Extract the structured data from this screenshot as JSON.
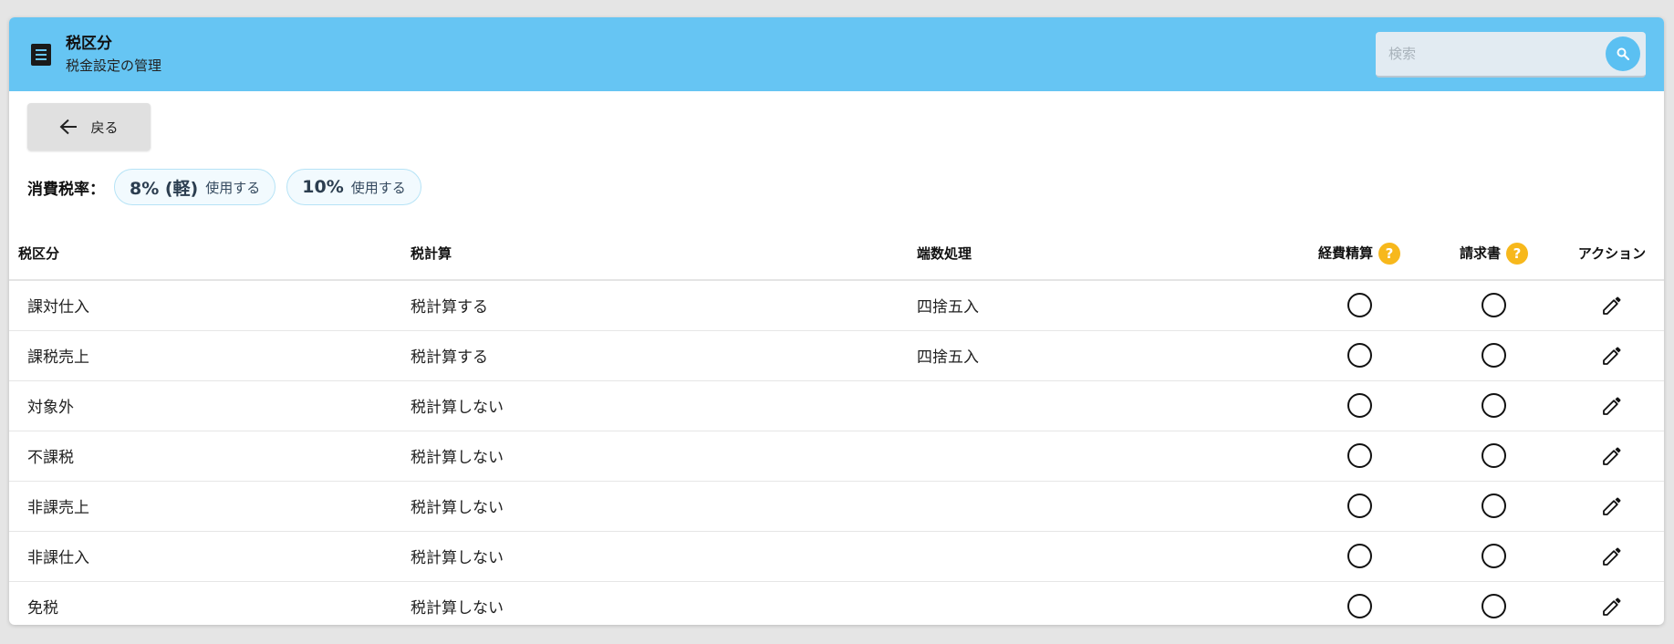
{
  "header": {
    "title": "税区分",
    "subtitle": "税金設定の管理",
    "search_placeholder": "検索"
  },
  "back_label": "戻る",
  "rates": {
    "label": "消費税率：",
    "items": [
      {
        "rate": "8% (軽)",
        "status": "使用する"
      },
      {
        "rate": "10%",
        "status": "使用する"
      }
    ]
  },
  "table": {
    "columns": [
      "税区分",
      "税計算",
      "端数処理",
      "経費精算",
      "請求書",
      "アクション"
    ],
    "help_glyph": "?",
    "rows": [
      {
        "category": "課対仕入",
        "calc": "税計算する",
        "rounding": "四捨五入",
        "expense": "〇",
        "invoice": "〇"
      },
      {
        "category": "課税売上",
        "calc": "税計算する",
        "rounding": "四捨五入",
        "expense": "〇",
        "invoice": "〇"
      },
      {
        "category": "対象外",
        "calc": "税計算しない",
        "rounding": "",
        "expense": "〇",
        "invoice": "〇"
      },
      {
        "category": "不課税",
        "calc": "税計算しない",
        "rounding": "",
        "expense": "〇",
        "invoice": "〇"
      },
      {
        "category": "非課売上",
        "calc": "税計算しない",
        "rounding": "",
        "expense": "〇",
        "invoice": "〇"
      },
      {
        "category": "非課仕入",
        "calc": "税計算しない",
        "rounding": "",
        "expense": "〇",
        "invoice": "〇"
      },
      {
        "category": "免税",
        "calc": "税計算しない",
        "rounding": "",
        "expense": "〇",
        "invoice": "〇"
      }
    ]
  },
  "icons": {
    "menu": "list-icon",
    "search": "search-icon",
    "back": "arrow-left-icon",
    "help": "help-icon",
    "edit": "pencil-icon",
    "mark": "circle-mark-icon"
  },
  "colors": {
    "header_bg": "#66c5f3",
    "accent": "#5bc0f2",
    "help_badge": "#f7b81c"
  }
}
